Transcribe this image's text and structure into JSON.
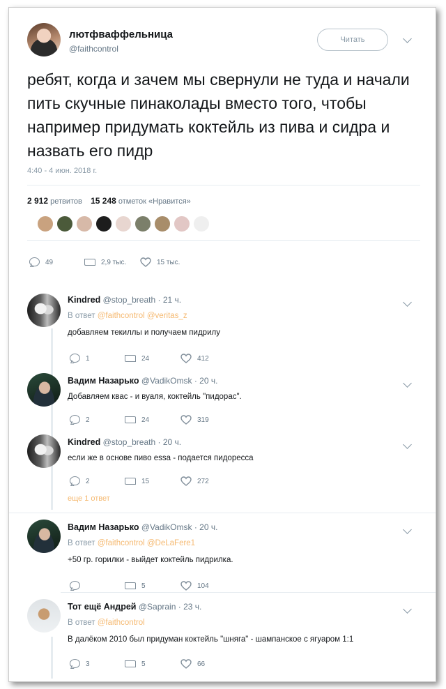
{
  "main": {
    "display_name": "лютфваффельница",
    "handle": "@faithcontrol",
    "follow_label": "Читать",
    "text": "ребят, когда и зачем мы свернули не туда и начали пить скучные пинаколады вместо того, чтобы например придумать коктейль из пива и сидра и назвать его пидр",
    "timestamp": "4:40 - 4 июн. 2018 г.",
    "retweets_count": "2 912",
    "retweets_label": "ретвитов",
    "likes_count": "15 248",
    "likes_label": "отметок «Нравится»",
    "actions": {
      "replies": "49",
      "retweets": "2,9 тыс.",
      "likes": "15 тыс."
    }
  },
  "replies": [
    {
      "name": "Kindred",
      "handle": "@stop_breath",
      "time": "21 ч.",
      "reply_prefix": "В ответ",
      "reply_to": "@faithcontrol @veritas_z",
      "text": "добавляем текиллы и получаем пидрилу",
      "counts": {
        "replies": "1",
        "retweets": "24",
        "likes": "412"
      }
    },
    {
      "name": "Вадим Назарько",
      "handle": "@VadikOmsk",
      "time": "20 ч.",
      "text": "Добавляем квас - и вуаля, коктейль \"пидорас\".",
      "counts": {
        "replies": "2",
        "retweets": "24",
        "likes": "319"
      }
    },
    {
      "name": "Kindred",
      "handle": "@stop_breath",
      "time": "20 ч.",
      "text": "если же в основе пиво essa - подается пидоресса",
      "counts": {
        "replies": "2",
        "retweets": "15",
        "likes": "272"
      }
    },
    {
      "more_label": "еще 1 ответ"
    },
    {
      "name": "Вадим Назарько",
      "handle": "@VadikOmsk",
      "time": "20 ч.",
      "reply_prefix": "В ответ",
      "reply_to": "@faithcontrol @DeLaFere1",
      "text": "+50 гр. горилки - выйдет коктейль пидрилка.",
      "counts": {
        "replies": "",
        "retweets": "5",
        "likes": "104"
      }
    },
    {
      "name": "Тот ещё Андрей",
      "handle": "@Saprain",
      "time": "23 ч.",
      "reply_prefix": "В ответ",
      "reply_to": "@faithcontrol",
      "text": "В далёком 2010 был придуман коктейль \"шняга\" - шампанское с ягуаром 1:1",
      "counts": {
        "replies": "3",
        "retweets": "5",
        "likes": "66"
      }
    }
  ],
  "icons": [
    "reply-icon",
    "retweet-icon",
    "heart-icon",
    "chevron-down-icon"
  ],
  "colors": {
    "link": "#f5b971",
    "muted": "#657786",
    "border": "#e6ecf0"
  }
}
